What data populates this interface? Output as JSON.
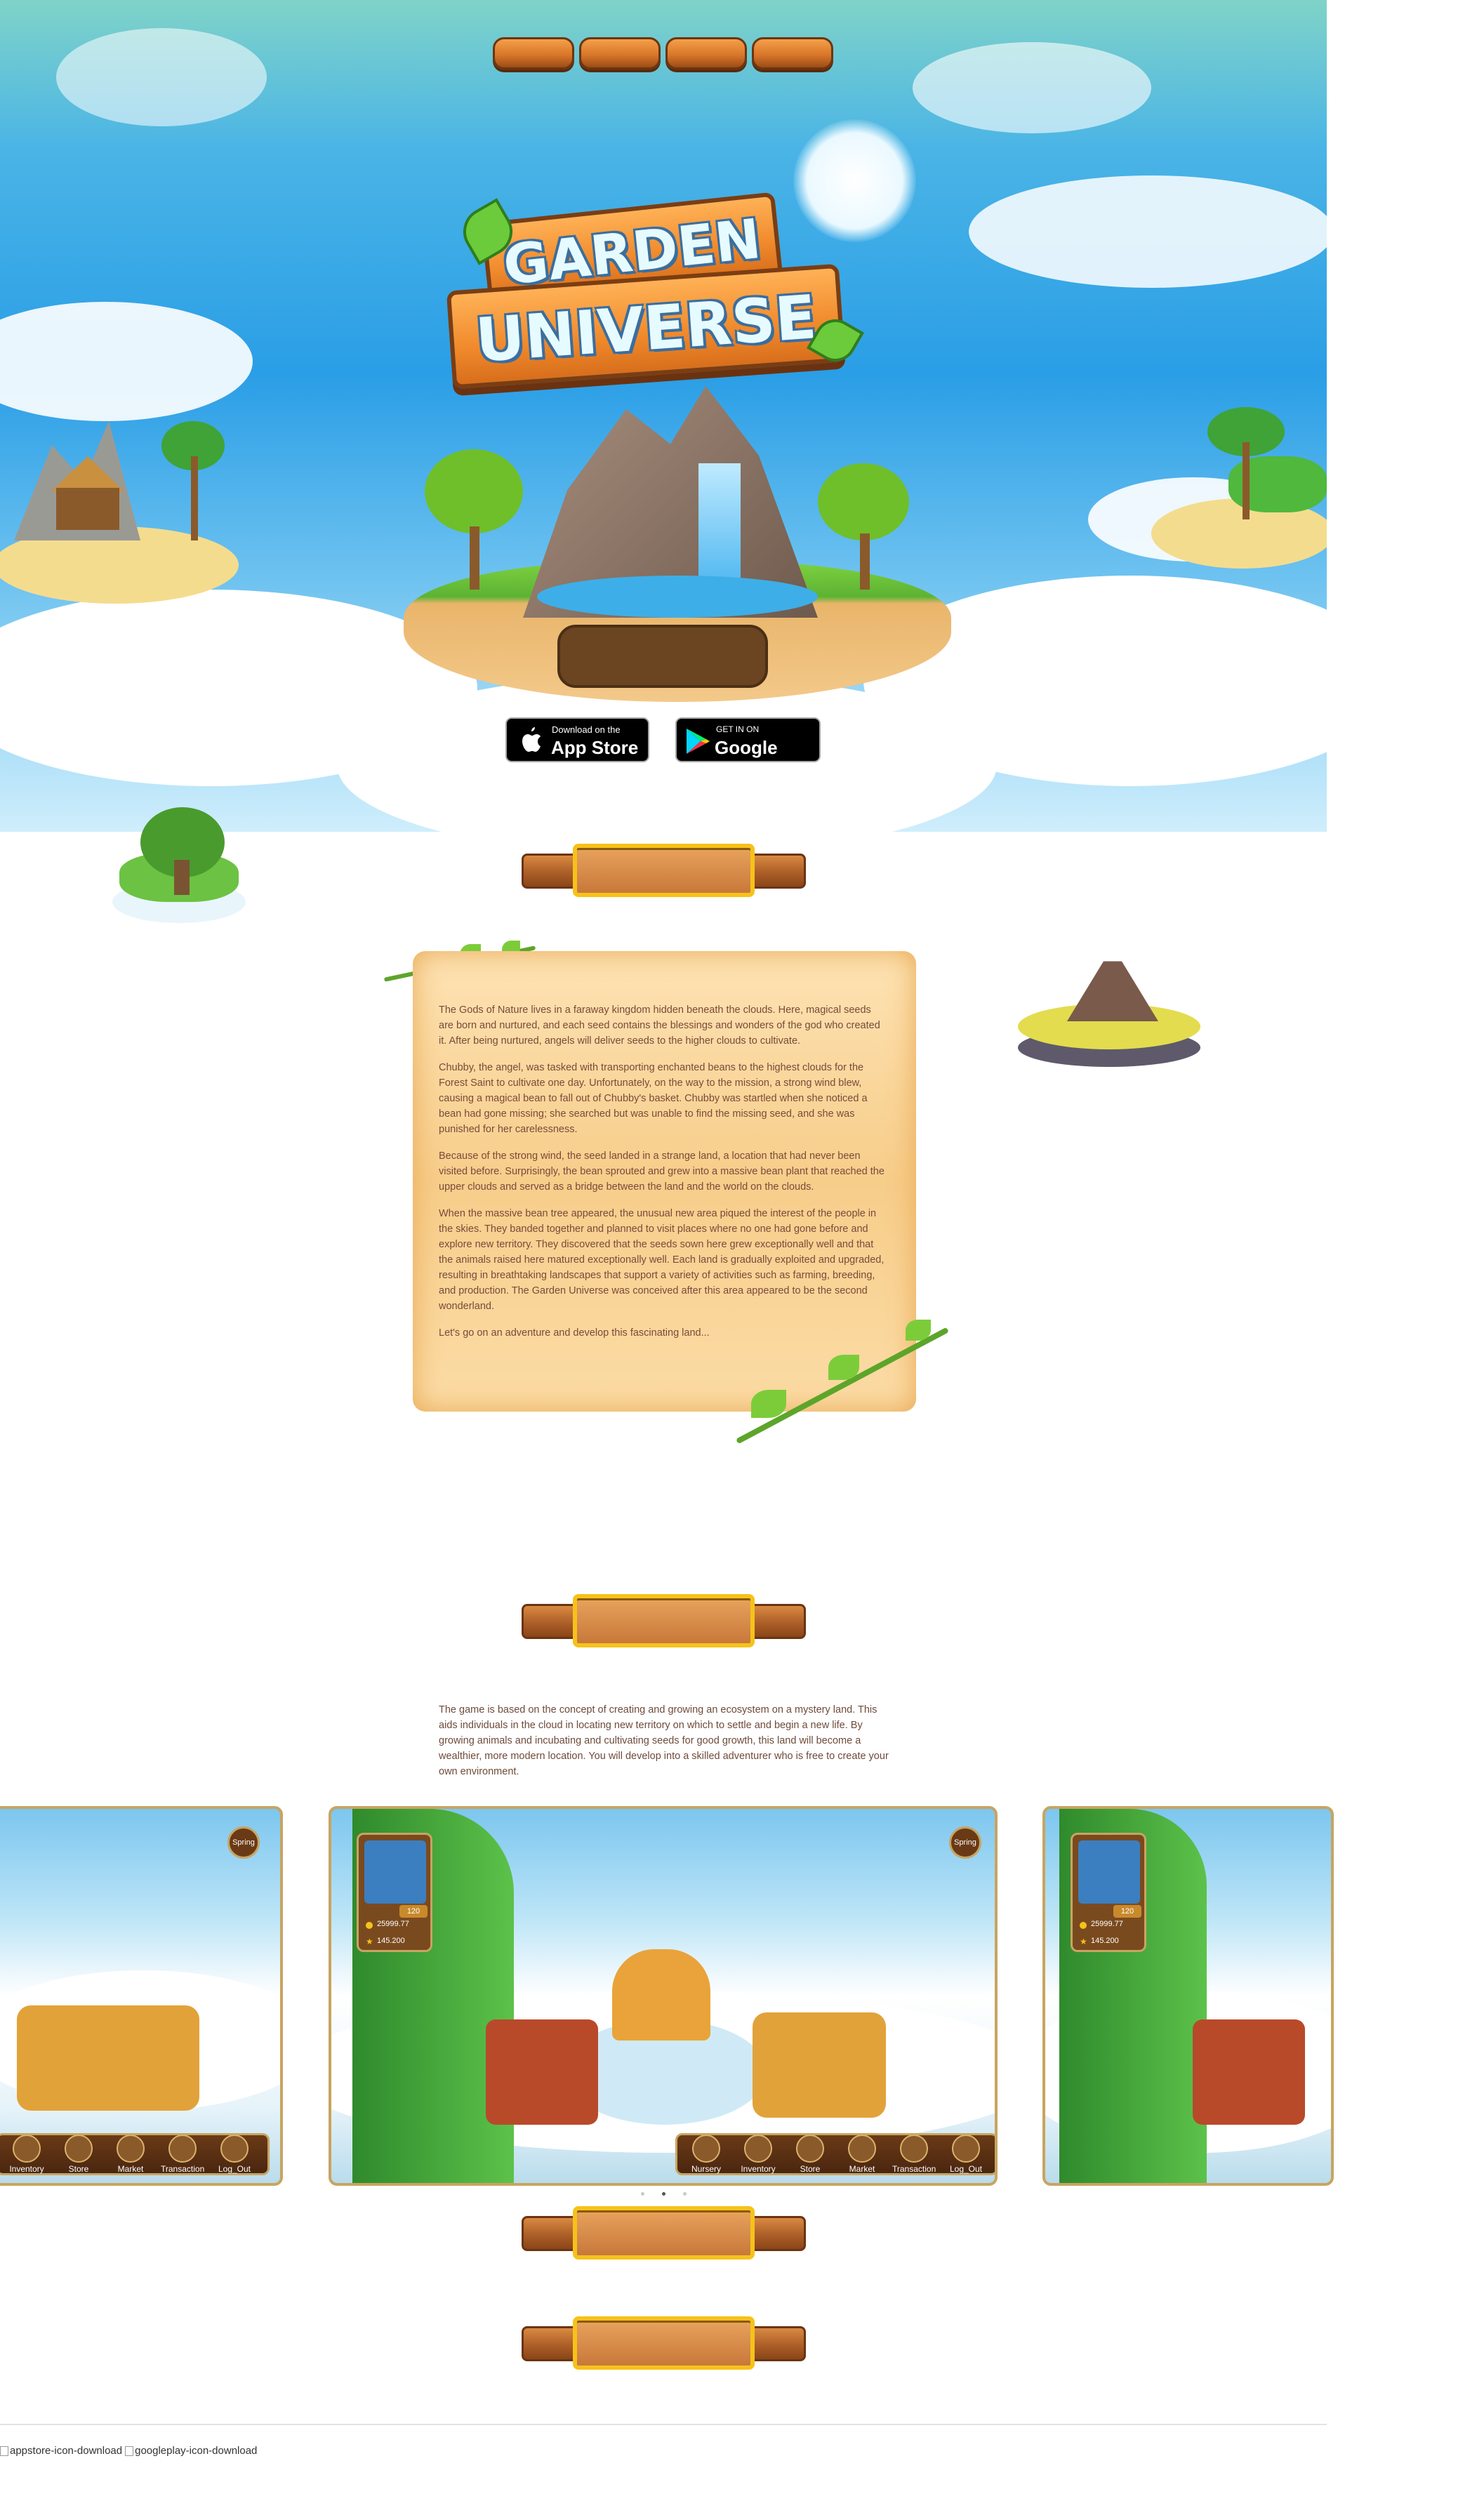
{
  "nav": {
    "buttons": [
      "",
      "",
      "",
      ""
    ]
  },
  "hero": {
    "logo_line1": "GARDEN",
    "logo_line2": "UNIVERSE",
    "play_button_label": "",
    "appstore_small": "Download on the",
    "appstore_big": "App Store",
    "googleplay_small": "GET IN ON",
    "googleplay_big": "Google Play"
  },
  "section1": {
    "title": ""
  },
  "story": {
    "paragraphs": [
      "The Gods of Nature lives in a faraway kingdom hidden beneath the clouds. Here, magical seeds are born and nurtured, and each seed contains the blessings and wonders of the god who created it. After being nurtured, angels will deliver seeds to the higher clouds to cultivate.",
      "Chubby, the angel, was tasked with transporting enchanted beans to the highest clouds for the Forest Saint to cultivate one day. Unfortunately, on the way to the mission, a strong wind blew, causing a magical bean to fall out of Chubby's basket. Chubby was startled when she noticed a bean had gone missing; she searched but was unable to find the missing seed, and she was punished for her carelessness.",
      "Because of the strong wind, the seed landed in a strange land, a location that had never been visited before. Surprisingly, the bean sprouted and grew into a massive bean plant that reached the upper clouds and served as a bridge between the land and the world on the clouds.",
      "When the massive bean tree appeared, the unusual new area piqued the interest of the people in the skies. They banded together and planned to visit places where no one had gone before and explore new territory. They discovered that the seeds sown here grew exceptionally well and that the animals raised here matured exceptionally well. Each land is gradually exploited and upgraded, resulting in breathtaking landscapes that support a variety of activities such as farming, breeding, and production. The Garden Universe was conceived after this area appeared to be the second wonderland.",
      "Let's go on an adventure and develop this fascinating land..."
    ]
  },
  "section2": {
    "title": "",
    "intro": "The game is based on the concept of creating and growing an ecosystem on a mystery land. This aids individuals in the cloud in locating new territory on which to settle and begin a new life. By growing animals and incubating and cultivating seeds for good growth, this land will become a wealthier, more modern location. You will develop into a skilled adventurer who is free to create your own environment."
  },
  "carousel": {
    "season": "Spring",
    "level": "120",
    "coins": "25999.77",
    "stars": "145.200",
    "menu": [
      "Nursery",
      "Inventory",
      "Store",
      "Market",
      "Transaction",
      "Log_Out"
    ],
    "left_menu": [
      "Inventory",
      "Store",
      "Market",
      "Transaction",
      "Log_Out"
    ]
  },
  "section3": {
    "title": ""
  },
  "section4": {
    "title": ""
  },
  "footer": {
    "appstore_alt": "appstore-icon-download",
    "googleplay_alt": "googleplay-icon-download"
  },
  "colors": {
    "wood": "#b0622a",
    "gold_frame": "#f6c21a",
    "text_brown": "#7a4a3a",
    "parchment": "#f7cd8a"
  }
}
